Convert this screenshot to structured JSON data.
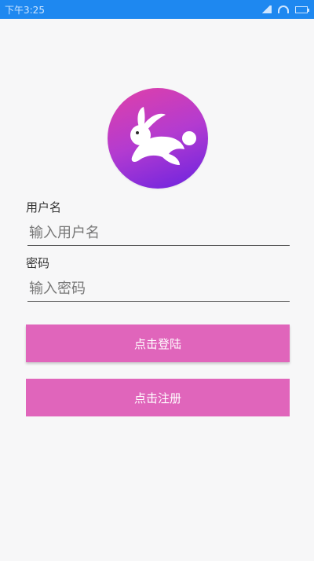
{
  "status_bar": {
    "time": "下午3:25",
    "color": "#1e88f0",
    "icons": [
      "signal-icon",
      "wifi-icon",
      "battery-icon"
    ]
  },
  "logo": {
    "icon": "rabbit-logo-icon",
    "gradient": [
      "#e040a8",
      "#6a22e0"
    ]
  },
  "form": {
    "username_label": "用户名",
    "username_placeholder": "输入用户名",
    "password_label": "密码",
    "password_placeholder": "输入密码"
  },
  "buttons": {
    "login_label": "点击登陆",
    "register_label": "点击注册",
    "color": "#e065bb"
  }
}
